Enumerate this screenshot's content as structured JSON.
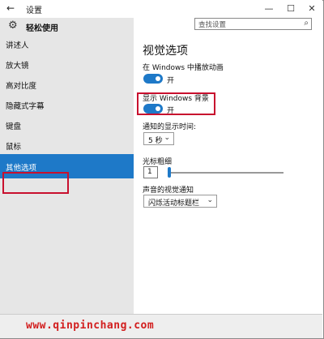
{
  "window": {
    "title": "设置",
    "back_icon": "←",
    "min_icon": "—",
    "max_icon": "☐",
    "close_icon": "✕"
  },
  "sidebar": {
    "header": {
      "icon": "⚙",
      "label": "轻松使用"
    },
    "items": [
      {
        "label": "讲述人",
        "active": false
      },
      {
        "label": "放大镜",
        "active": false
      },
      {
        "label": "高对比度",
        "active": false
      },
      {
        "label": "隐藏式字幕",
        "active": false
      },
      {
        "label": "键盘",
        "active": false
      },
      {
        "label": "鼠标",
        "active": false
      },
      {
        "label": "其他选项",
        "active": true
      }
    ]
  },
  "search": {
    "placeholder": "查找设置",
    "icon": "⌕"
  },
  "main": {
    "title": "视觉选项",
    "animations": {
      "label": "在 Windows 中播放动画",
      "state": "开"
    },
    "background": {
      "label": "显示 Windows 背景",
      "state": "开"
    },
    "notify_time": {
      "label": "通知的显示时间:",
      "value": "5 秒",
      "chev": "⌄"
    },
    "cursor": {
      "label": "光标粗细",
      "value": "1"
    },
    "sound": {
      "label": "声音的视觉通知",
      "value": "闪烁活动标题栏",
      "chev": "⌄"
    }
  },
  "footer": {
    "watermark": "www.qinpinchang.com"
  },
  "colors": {
    "accent": "#1e79c8",
    "highlight": "#c8102e",
    "sidebar_bg": "#e6e6e6"
  }
}
